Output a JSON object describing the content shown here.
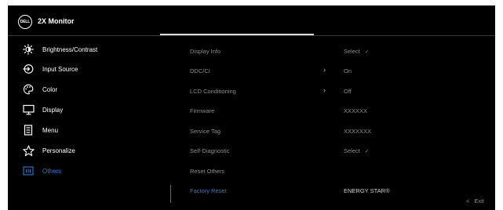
{
  "header": {
    "logo_text": "DELL",
    "title": "2X Monitor"
  },
  "sidebar": {
    "items": [
      {
        "label": "Brightness/Contrast",
        "icon": "brightness-icon"
      },
      {
        "label": "Input Source",
        "icon": "input-source-icon"
      },
      {
        "label": "Color",
        "icon": "color-palette-icon"
      },
      {
        "label": "Display",
        "icon": "display-icon"
      },
      {
        "label": "Menu",
        "icon": "menu-icon"
      },
      {
        "label": "Personalize",
        "icon": "star-icon"
      },
      {
        "label": "Others",
        "icon": "others-icon",
        "active": true
      }
    ]
  },
  "submenu": {
    "items": [
      {
        "label": "Display Info",
        "value": "Select",
        "value_check": "✓"
      },
      {
        "label": "DDC/CI",
        "chevron": "›",
        "value": "On"
      },
      {
        "label": "LCD Conditioning",
        "chevron": "›",
        "value": "Off"
      },
      {
        "label": "Firmware",
        "value": "XXXXXX"
      },
      {
        "label": "Service Tag",
        "value": "XXXXXXX"
      },
      {
        "label": "Self-Diagnostic",
        "value": "Select",
        "value_check": "✓"
      },
      {
        "label": "Reset Others"
      },
      {
        "label": "Factory Reset",
        "value": "ENERGY STAR®",
        "highlight": true
      }
    ]
  },
  "footer": {
    "exit_chevron": "<",
    "exit_label": "Exit"
  },
  "colors": {
    "background": "#000000",
    "accent": "#1e7fd8",
    "muted_text": "#8c8c8c"
  }
}
